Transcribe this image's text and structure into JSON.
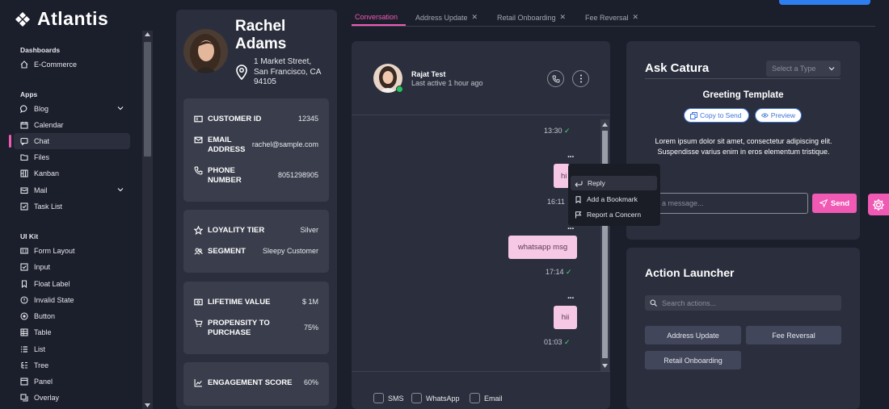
{
  "app": {
    "name": "Atlantis"
  },
  "sidebar": {
    "sections": {
      "dashboards": "Dashboards",
      "apps": "Apps",
      "uikit": "UI Kit"
    },
    "items": [
      {
        "label": "E-Commerce",
        "icon": "home-icon"
      },
      {
        "label": "Blog",
        "icon": "comment-icon"
      },
      {
        "label": "Calendar",
        "icon": "calendar-icon"
      },
      {
        "label": "Chat",
        "icon": "chat-icon"
      },
      {
        "label": "Files",
        "icon": "folder-icon"
      },
      {
        "label": "Kanban",
        "icon": "kanban-icon"
      },
      {
        "label": "Mail",
        "icon": "mail-icon"
      },
      {
        "label": "Task List",
        "icon": "checkbox-icon"
      },
      {
        "label": "Form Layout",
        "icon": "id-card-icon"
      },
      {
        "label": "Input",
        "icon": "check-square-icon"
      },
      {
        "label": "Float Label",
        "icon": "bookmark-icon"
      },
      {
        "label": "Invalid State",
        "icon": "exclamation-circle-icon"
      },
      {
        "label": "Button",
        "icon": "circle-icon"
      },
      {
        "label": "Table",
        "icon": "table-icon"
      },
      {
        "label": "List",
        "icon": "list-icon"
      },
      {
        "label": "Tree",
        "icon": "tree-icon"
      },
      {
        "label": "Panel",
        "icon": "panel-icon"
      },
      {
        "label": "Overlay",
        "icon": "overlay-icon"
      }
    ]
  },
  "customer": {
    "first_name": "Rachel",
    "last_name": "Adams",
    "address": [
      "1 Market Street,",
      "San Francisco, CA",
      "94105"
    ],
    "id_label": "CUSTOMER ID",
    "id_value": "12345",
    "email_label": [
      "EMAIL",
      "ADDRESS"
    ],
    "email_value": "rachel@sample.com",
    "phone_label": [
      "PHONE",
      "NUMBER"
    ],
    "phone_value": "8051298905",
    "loyalty_label": "LOYALITY TIER",
    "loyalty_value": "Silver",
    "segment_label": "SEGMENT",
    "segment_value": "Sleepy Customer",
    "ltv_label": "LIFETIME VALUE",
    "ltv_value": "$ 1M",
    "propensity_label": [
      "PROPENSITY TO",
      "PURCHASE"
    ],
    "propensity_value": "75%",
    "engagement_label": "ENGAGEMENT SCORE",
    "engagement_value": "60%"
  },
  "tabs": [
    "Conversation",
    "Address Update",
    "Retail Onboarding",
    "Fee Reversal"
  ],
  "conversation": {
    "contact_name": "Rajat Test",
    "contact_status": "Last active 1 hour ago",
    "messages": [
      {
        "text": "",
        "time": "13:30"
      },
      {
        "text": "hi",
        "time": "16:11"
      },
      {
        "text": "whatsapp msg",
        "time": "17:14"
      },
      {
        "text": "hii",
        "time": "01:03"
      }
    ],
    "context_menu": [
      "Reply",
      "Add a Bookmark",
      "Report a Concern"
    ],
    "channels": [
      "SMS",
      "WhatsApp",
      "Email"
    ]
  },
  "ask": {
    "title": "Ask Catura",
    "type_placeholder": "Select a Type",
    "template_title": "Greeting Template",
    "copy_label": "Copy to Send",
    "preview_label": "Preview",
    "body": "Lorem ipsum dolor sit amet, consectetur adipiscing elit. Suspendisse varius enim in eros elementum tristique.",
    "message_placeholder": "a message...",
    "send_label": "Send"
  },
  "action": {
    "title": "Action Launcher",
    "search_placeholder": "Search actions...",
    "buttons": [
      "Address Update",
      "Fee Reversal",
      "Retail Onboarding"
    ]
  },
  "colors": {
    "accent": "#f05ab4",
    "bubble": "#f7c8e6",
    "panel": "#2b2f3d",
    "bg": "#1b1e2b"
  }
}
